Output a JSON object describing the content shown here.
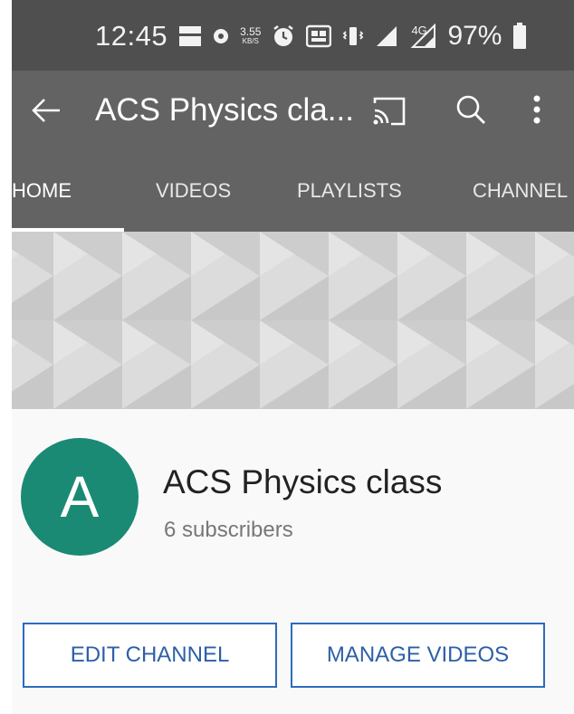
{
  "status_bar": {
    "time": "12:45",
    "data_speed": "3.55",
    "data_unit": "KB/S",
    "signal_label": "4G",
    "battery_percent": "97%"
  },
  "app_bar": {
    "title": "ACS Physics cla...",
    "icons": [
      "back-arrow-icon",
      "cast-icon",
      "search-icon",
      "more-vert-icon"
    ]
  },
  "tabs": [
    {
      "label": "HOME",
      "selected": true
    },
    {
      "label": "VIDEOS",
      "selected": false
    },
    {
      "label": "PLAYLISTS",
      "selected": false
    },
    {
      "label": "CHANNEL",
      "selected": false
    }
  ],
  "channel": {
    "avatar_letter": "A",
    "name": "ACS Physics class",
    "subscribers": "6 subscribers"
  },
  "actions": {
    "edit_label": "EDIT CHANNEL",
    "manage_label": "MANAGE VIDEOS"
  },
  "colors": {
    "status_bar_bg": "#4f4f4f",
    "app_bar_bg": "#636363",
    "avatar_bg": "#1a8a74",
    "button_text": "#2d5fa8"
  }
}
